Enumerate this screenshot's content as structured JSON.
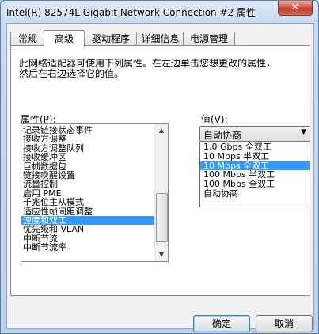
{
  "window": {
    "title": "Intel(R) 82574L Gigabit Network Connection #2 属性",
    "close_glyph": "✕"
  },
  "tabs": [
    {
      "label": "常规",
      "active": false
    },
    {
      "label": "高级",
      "active": true
    },
    {
      "label": "驱动程序",
      "active": false
    },
    {
      "label": "详细信息",
      "active": false
    },
    {
      "label": "电源管理",
      "active": false
    }
  ],
  "advanced": {
    "description_line1": "此网络适配器可使用下列属性。在左边单击您想更改的属性，",
    "description_line2": "然后在右边选择它的值。",
    "property_label": "属性(P):",
    "value_label": "值(V):",
    "properties": [
      "记录链接状态事件",
      "接收方调整",
      "接收方调整队列",
      "接收缓冲区",
      "巨帧数据包",
      "链接唤醒设置",
      "流量控制",
      "启用 PME",
      "千兆位主从模式",
      "适应性帧间距调整",
      "速度和双工",
      "优先级和 VLAN",
      "中断节流",
      "中断节流率"
    ],
    "selected_property": "速度和双工",
    "current_value": "自动协商",
    "value_options": [
      "1.0 Gbps 全双工",
      "10 Mbps 半双工",
      "10 Mbps 全双工",
      "100 Mbps 半双工",
      "100 Mbps 全双工",
      "自动协商"
    ],
    "highlighted_value": "10 Mbps 全双工"
  },
  "buttons": {
    "ok": "确定",
    "cancel": "取消"
  },
  "icons": {
    "combo_arrow": "▼",
    "scroll_up": "▲",
    "scroll_down": "▼"
  }
}
